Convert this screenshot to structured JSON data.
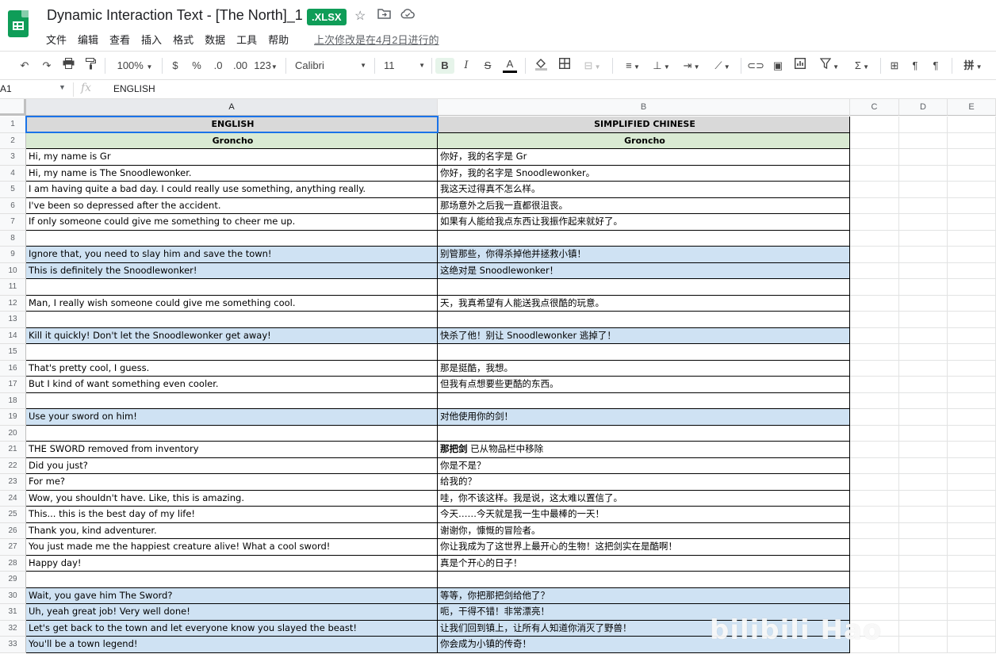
{
  "header": {
    "title": "Dynamic Interaction Text - [The North]_1",
    "badge": ".XLSX",
    "menu": [
      "文件",
      "编辑",
      "查看",
      "插入",
      "格式",
      "数据",
      "工具",
      "帮助"
    ],
    "last_edit": "上次修改是在4月2日进行的"
  },
  "toolbar": {
    "zoom": "100%",
    "currency": "$",
    "percent": "%",
    "dec_less": ".0",
    "dec_more": ".00",
    "format": "123",
    "font": "Calibri",
    "font_size": "11",
    "bold": "B",
    "italic": "I",
    "strike": "S",
    "text_color": "A",
    "input_tool": "拼"
  },
  "formula_bar": {
    "cell_ref": "A1",
    "fx": "fx",
    "content": "ENGLISH"
  },
  "columns": [
    "A",
    "B",
    "C",
    "D",
    "E"
  ],
  "rows": [
    {
      "n": "1",
      "a": "ENGLISH",
      "b": "SIMPLIFIED CHINESE",
      "style": "head-gray"
    },
    {
      "n": "2",
      "a": "Groncho",
      "b": "Groncho",
      "style": "head-green"
    },
    {
      "n": "3",
      "a": "Hi, my name is Gr",
      "b": "你好，我的名字是 Gr",
      "style": ""
    },
    {
      "n": "4",
      "a": "Hi, my name is The Snoodlewonker.",
      "b": "你好，我的名字是 Snoodlewonker。",
      "style": ""
    },
    {
      "n": "5",
      "a": "I am having quite a bad day. I could really use something, anything really.",
      "b": "我这天过得真不怎么样。",
      "style": ""
    },
    {
      "n": "6",
      "a": "I've been so depressed after the accident.",
      "b": "那场意外之后我一直都很沮丧。",
      "style": ""
    },
    {
      "n": "7",
      "a": "If only someone could give me something to cheer me up.",
      "b": "如果有人能给我点东西让我振作起来就好了。",
      "style": ""
    },
    {
      "n": "8",
      "a": "",
      "b": "",
      "style": ""
    },
    {
      "n": "9",
      "a": "Ignore that, you need to slay him and save the town!",
      "b": "别管那些，你得杀掉他并拯救小镇！",
      "style": "blue"
    },
    {
      "n": "10",
      "a": "This is definitely the Snoodlewonker!",
      "b": "这绝对是 Snoodlewonker！",
      "style": "blue"
    },
    {
      "n": "11",
      "a": "",
      "b": "",
      "style": ""
    },
    {
      "n": "12",
      "a": "Man, I really wish someone could give me something cool.",
      "b": "天，我真希望有人能送我点很酷的玩意。",
      "style": ""
    },
    {
      "n": "13",
      "a": "",
      "b": "",
      "style": ""
    },
    {
      "n": "14",
      "a": "Kill it quickly! Don't let the Snoodlewonker get away!",
      "b": "快杀了他！别让 Snoodlewonker 逃掉了！",
      "style": "blue"
    },
    {
      "n": "15",
      "a": "",
      "b": "",
      "style": ""
    },
    {
      "n": "16",
      "a": "That's pretty cool, I guess.",
      "b": "那是挺酷，我想。",
      "style": ""
    },
    {
      "n": "17",
      "a": "But I kind of want something even cooler.",
      "b": "但我有点想要些更酷的东西。",
      "style": ""
    },
    {
      "n": "18",
      "a": "",
      "b": "",
      "style": ""
    },
    {
      "n": "19",
      "a": "Use your sword on him!",
      "b": "对他使用你的剑！",
      "style": "blue"
    },
    {
      "n": "20",
      "a": "",
      "b": "",
      "style": ""
    },
    {
      "n": "21",
      "a": "THE SWORD removed from inventory",
      "b": "那把剑 已从物品栏中移除",
      "b_bold": "那把剑",
      "b_rest": " 已从物品栏中移除",
      "style": ""
    },
    {
      "n": "22",
      "a": "Did you just?",
      "b": "你是不是？",
      "style": ""
    },
    {
      "n": "23",
      "a": "For me?",
      "b": "给我的？",
      "style": ""
    },
    {
      "n": "24",
      "a": "Wow, you shouldn't have. Like, this is amazing.",
      "b": "哇，你不该这样。我是说，这太难以置信了。",
      "style": ""
    },
    {
      "n": "25",
      "a": "This... this is the best day of my life!",
      "b": "今天……今天就是我一生中最棒的一天！",
      "style": ""
    },
    {
      "n": "26",
      "a": "Thank you, kind adventurer.",
      "b": "谢谢你，慷慨的冒险者。",
      "style": ""
    },
    {
      "n": "27",
      "a": "You just made me the happiest creature alive! What a cool sword!",
      "b": "你让我成为了这世界上最开心的生物！这把剑实在是酷啊！",
      "style": ""
    },
    {
      "n": "28",
      "a": "Happy day!",
      "b": "真是个开心的日子！",
      "style": ""
    },
    {
      "n": "29",
      "a": "",
      "b": "",
      "style": ""
    },
    {
      "n": "30",
      "a": "Wait, you gave him The Sword?",
      "b": "等等，你把那把剑给他了？",
      "style": "blue"
    },
    {
      "n": "31",
      "a": "Uh, yeah great job! Very well done!",
      "b": "呃，干得不错！非常漂亮！",
      "style": "blue"
    },
    {
      "n": "32",
      "a": "Let's get back to the town and let everyone know you slayed the beast!",
      "b": "让我们回到镇上，让所有人知道你消灭了野兽！",
      "style": "blue"
    },
    {
      "n": "33",
      "a": "You'll be a town legend!",
      "b": "你会成为小镇的传奇！",
      "style": "blue"
    }
  ],
  "watermark": "bilibili Hao"
}
